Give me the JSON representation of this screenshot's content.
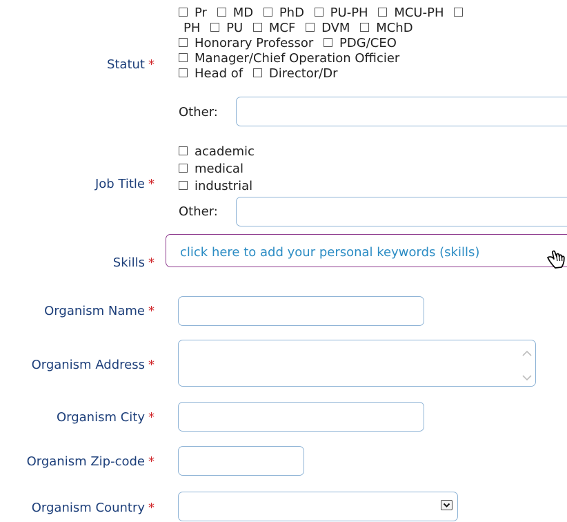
{
  "required_mark": "*",
  "statut": {
    "label": "Statut",
    "lines": [
      [
        "Pr",
        "MD",
        "PhD",
        "PU-PH",
        "MCU-PH",
        ""
      ],
      [
        "PH",
        "PU",
        "MCF",
        "DVM",
        "MChD"
      ],
      [
        "Honorary Professor",
        "PDG/CEO"
      ],
      [
        "Manager/Chief Operation Officier"
      ],
      [
        "Head of",
        "Director/Dr"
      ]
    ],
    "other_label": "Other:",
    "other_value": ""
  },
  "job_title": {
    "label": "Job Title",
    "options": [
      "academic",
      "medical",
      "industrial"
    ],
    "other_label": "Other:",
    "other_value": ""
  },
  "skills": {
    "label": "Skills",
    "prompt": "click here to add your personal keywords (skills)",
    "icon": "pointing-hand-icon"
  },
  "organism_name": {
    "label": "Organism Name",
    "value": ""
  },
  "organism_address": {
    "label": "Organism Address",
    "value": ""
  },
  "organism_city": {
    "label": "Organism City",
    "value": ""
  },
  "organism_zipcode": {
    "label": "Organism Zip-code",
    "value": ""
  },
  "organism_country": {
    "label": "Organism Country",
    "value": ""
  },
  "colors": {
    "label": "#1d3f7a",
    "required": "#d0262a",
    "field_border": "#8fb4d6",
    "skills_border": "#8e3b8e",
    "skills_text": "#2b8cc4"
  }
}
